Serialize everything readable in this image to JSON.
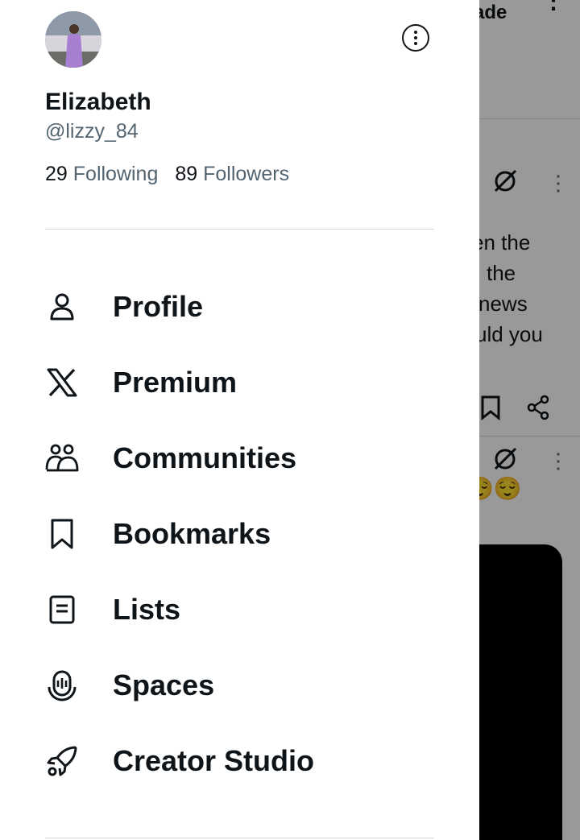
{
  "profile": {
    "name": "Elizabeth",
    "handle": "@lizzy_84",
    "following_count": "29",
    "following_label": "Following",
    "followers_count": "89",
    "followers_label": "Followers"
  },
  "menu": [
    {
      "label": "Profile",
      "icon": "person-icon"
    },
    {
      "label": "Premium",
      "icon": "x-logo-icon"
    },
    {
      "label": "Communities",
      "icon": "communities-icon"
    },
    {
      "label": "Bookmarks",
      "icon": "bookmark-icon"
    },
    {
      "label": "Lists",
      "icon": "list-icon"
    },
    {
      "label": "Spaces",
      "icon": "spaces-icon"
    },
    {
      "label": "Creator Studio",
      "icon": "rocket-icon"
    }
  ],
  "background": {
    "header_fragment": "ade",
    "post_lines": [
      "en the",
      "the",
      "news",
      "uld you"
    ],
    "emoji": "😌😌"
  }
}
